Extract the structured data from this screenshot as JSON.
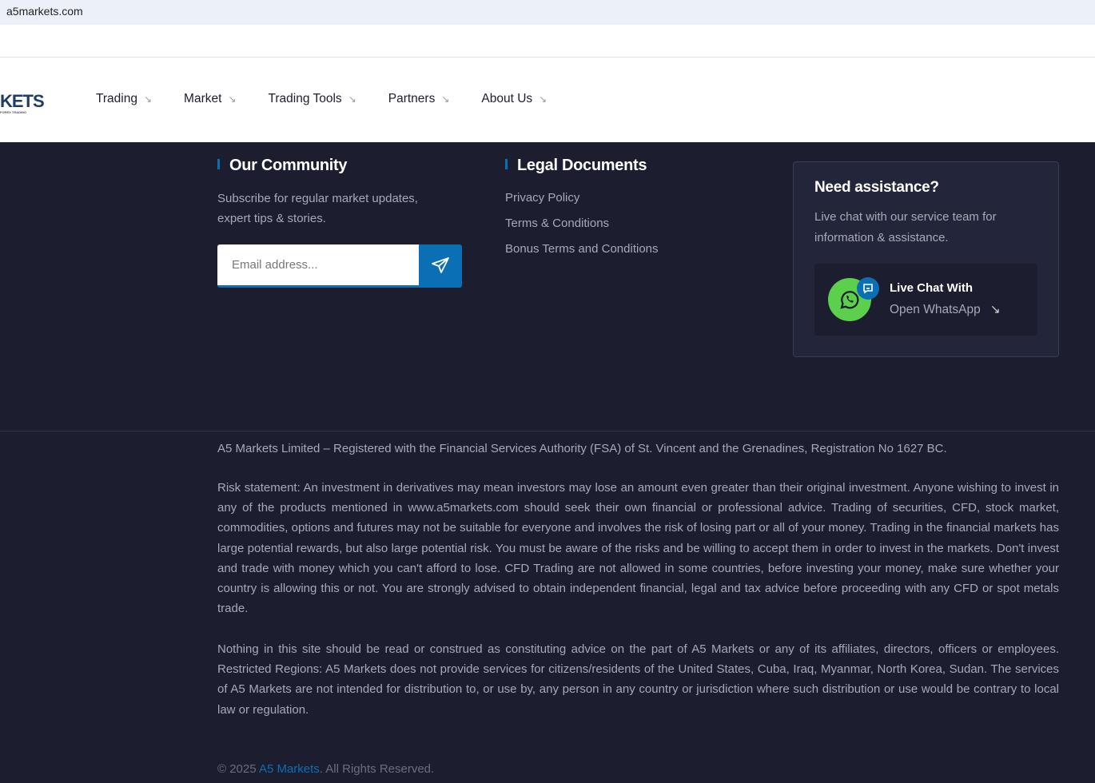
{
  "browser": {
    "url": "a5markets.com"
  },
  "header": {
    "logo_text": "KETS",
    "logo_sub": "FOREX TRADING",
    "nav": [
      {
        "label": "Trading"
      },
      {
        "label": "Market"
      },
      {
        "label": "Trading Tools"
      },
      {
        "label": "Partners"
      },
      {
        "label": "About Us"
      }
    ],
    "nav_arrow": "↘"
  },
  "community": {
    "title": "Our Community",
    "text": "Subscribe for regular market updates, expert tips & stories.",
    "email_placeholder": "Email address...",
    "send_icon": "paper-plane-icon"
  },
  "legal": {
    "title": "Legal Documents",
    "links": [
      "Privacy Policy",
      "Terms & Conditions",
      "Bonus Terms and Conditions"
    ]
  },
  "assist": {
    "title": "Need assistance?",
    "text": "Live chat with our service team for information & assistance.",
    "chat_title": "Live Chat With",
    "chat_link": "Open WhatsApp",
    "arrow": "↘"
  },
  "footer": {
    "registration": "A5 Markets Limited – Registered with the Financial Services Authority (FSA) of St. Vincent and the Grenadines, Registration No 1627 BC.",
    "risk": "Risk statement: An investment in derivatives may mean investors may lose an amount even greater than their original investment. Anyone wishing to invest in any of the products mentioned in www.a5markets.com should seek their own financial or professional advice. Trading of securities, CFD, stock market, commodities, options and futures may not be suitable for everyone and involves the risk of losing part or all of your money. Trading in the financial markets has large potential rewards, but also large potential risk. You must be aware of the risks and be willing to accept them in order to invest in the markets. Don't invest and trade with money which you can't afford to lose. CFD Trading are not allowed in some countries, before investing your money, make sure whether your country is allowing this or not. You are strongly advised to obtain independent financial, legal and tax advice before proceeding with any CFD or spot metals trade.",
    "nothing": "Nothing in this site should be read or construed as constituting advice on the part of A5 Markets or any of its affiliates, directors, officers or employees. Restricted Regions: A5 Markets does not provide services for citizens/residents of the United States, Cuba, Iraq, Myanmar, North Korea, Sudan. The services of A5 Markets are not intended for distribution to, or use by, any person in any country or jurisdiction where such distribution or use would be contrary to local law or regulation.",
    "copy_prefix": "© 2025 ",
    "copy_brand": "A5 Markets",
    "copy_suffix": ". All Rights Reserved."
  },
  "colors": {
    "accent": "#0a6fb5",
    "background": "#1c1e30",
    "whatsapp": "#5cd04c"
  }
}
